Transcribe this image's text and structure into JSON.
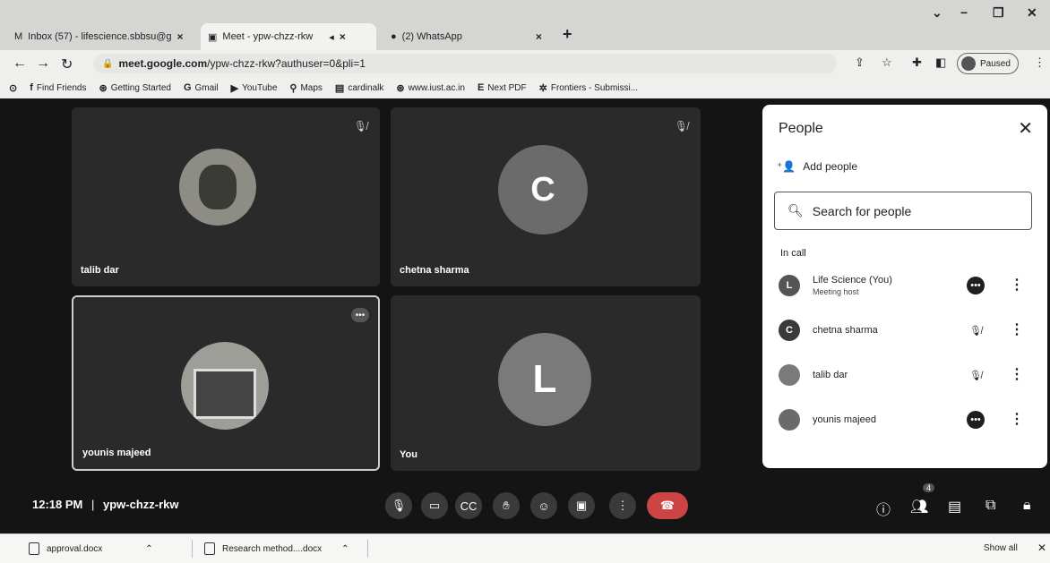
{
  "browser": {
    "tabs": [
      {
        "title": "Inbox (57) - lifescience.sbbsu@g"
      },
      {
        "title": "Meet - ypw-chzz-rkw"
      },
      {
        "title": "(2) WhatsApp"
      }
    ],
    "address": {
      "domain": "meet.google.com",
      "path": "/ypw-chzz-rkw?authuser=0&pli=1"
    },
    "profile_label": "Paused",
    "bookmarks": [
      {
        "label": "Find Friends"
      },
      {
        "label": "Getting Started"
      },
      {
        "label": "Gmail"
      },
      {
        "label": "YouTube"
      },
      {
        "label": "Maps"
      },
      {
        "label": "cardinalk"
      },
      {
        "label": "www.iust.ac.in"
      },
      {
        "label": "Next PDF"
      },
      {
        "label": "Frontiers - Submissi..."
      }
    ]
  },
  "meet": {
    "tiles": [
      {
        "name": "talib dar",
        "type": "photo"
      },
      {
        "name": "chetna sharma",
        "type": "letter",
        "letter": "C",
        "color": "#6b6b6b"
      },
      {
        "name": "younis majeed",
        "type": "photo"
      },
      {
        "name": "You",
        "type": "letter",
        "letter": "L",
        "color": "#7a7a7a"
      }
    ],
    "time": "12:18 PM",
    "separator": "|",
    "meeting_code": "ypw-chzz-rkw",
    "people_count": "4"
  },
  "people_panel": {
    "title": "People",
    "add_people": "Add people",
    "search_placeholder": "Search for people",
    "section_label": "In call",
    "participants": [
      {
        "name": "Life Science (You)",
        "subtitle": "Meeting host",
        "initial": "L",
        "avatar_color": "#555555",
        "status": "dots"
      },
      {
        "name": "chetna sharma",
        "subtitle": "",
        "initial": "C",
        "avatar_color": "#3a3a3a",
        "status": "muted"
      },
      {
        "name": "talib dar",
        "subtitle": "",
        "initial": "",
        "avatar_color": "#7a7a7a",
        "status": "muted"
      },
      {
        "name": "younis majeed",
        "subtitle": "",
        "initial": "",
        "avatar_color": "#6a6a6a",
        "status": "dots"
      }
    ]
  },
  "downloads": {
    "items": [
      {
        "filename": "approval.docx"
      },
      {
        "filename": "Research method....docx"
      }
    ],
    "show_all": "Show all"
  }
}
